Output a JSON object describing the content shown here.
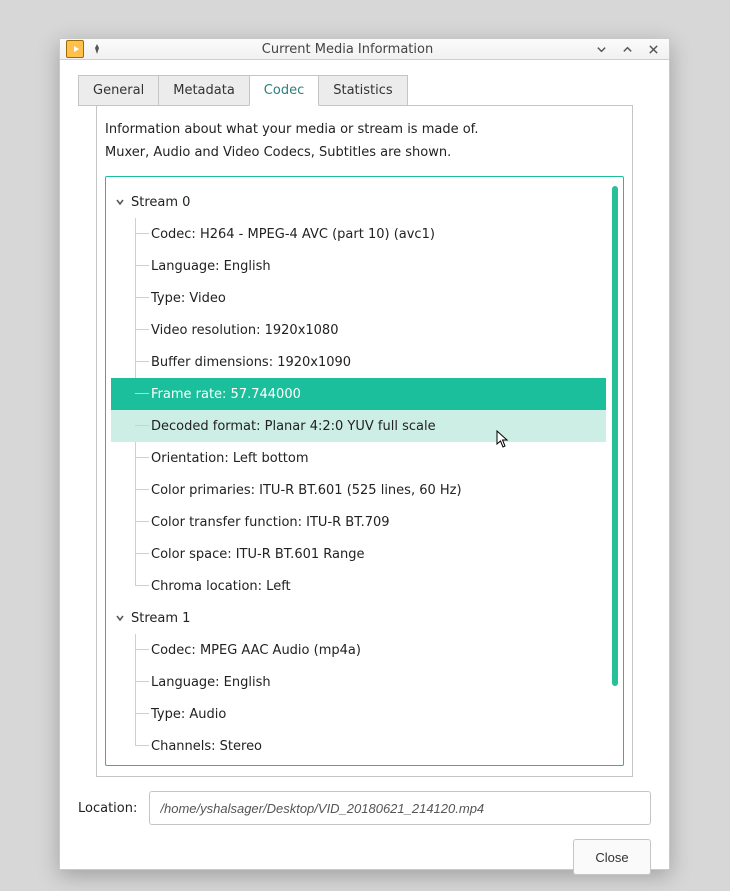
{
  "window": {
    "title": "Current Media Information"
  },
  "tabs": [
    "General",
    "Metadata",
    "Codec",
    "Statistics"
  ],
  "active_tab": 2,
  "description": {
    "line1": "Information about what your media or stream is made of.",
    "line2": "Muxer, Audio and Video Codecs, Subtitles are shown."
  },
  "streams": [
    {
      "label": "Stream 0",
      "items": [
        "Codec: H264 - MPEG-4 AVC (part 10) (avc1)",
        "Language: English",
        "Type: Video",
        "Video resolution: 1920x1080",
        "Buffer dimensions: 1920x1090",
        "Frame rate: 57.744000",
        "Decoded format: Planar 4:2:0 YUV full scale",
        "Orientation: Left bottom",
        "Color primaries: ITU-R BT.601 (525 lines, 60 Hz)",
        "Color transfer function: ITU-R BT.709",
        "Color space: ITU-R BT.601 Range",
        "Chroma location: Left"
      ],
      "selected_index": 5,
      "hover_index": 6
    },
    {
      "label": "Stream 1",
      "items": [
        "Codec: MPEG AAC Audio (mp4a)",
        "Language: English",
        "Type: Audio",
        "Channels: Stereo"
      ]
    }
  ],
  "location": {
    "label": "Location:",
    "value": "/home/yshalsager/Desktop/VID_20180621_214120.mp4"
  },
  "buttons": {
    "close": "Close"
  }
}
